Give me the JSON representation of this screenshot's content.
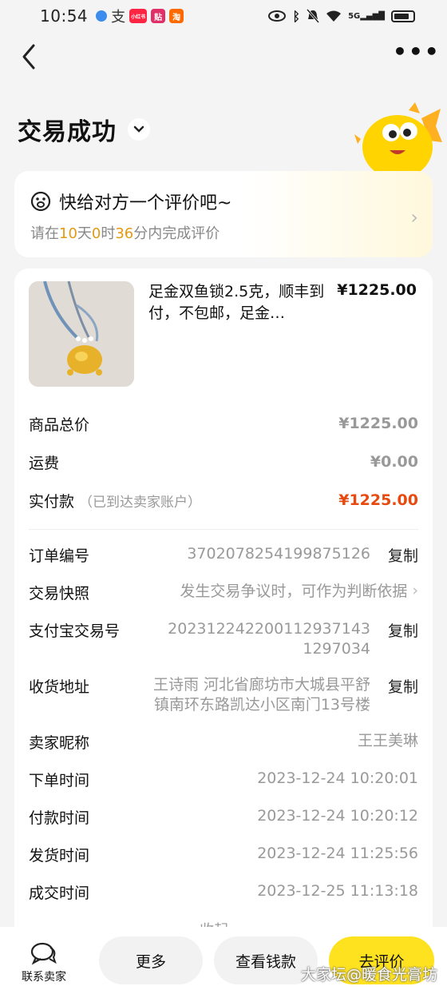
{
  "status_bar": {
    "time": "10:54",
    "network": "5G",
    "apps": [
      "小红书",
      "贴",
      "淘"
    ]
  },
  "page_title": "交易成功",
  "review_prompt": {
    "title": "快给对方一个评价吧~",
    "sub_prefix": "请在",
    "days": "10",
    "days_unit": "天",
    "hours": "0",
    "hours_unit": "时",
    "minutes": "36",
    "minutes_unit": "分内完成评价"
  },
  "product": {
    "title": "足金双鱼锁2.5克，顺丰到付，不包邮，足金…",
    "price": "¥1225.00"
  },
  "prices": {
    "total_label": "商品总价",
    "total_value": "¥1225.00",
    "shipping_label": "运费",
    "shipping_value": "¥0.00",
    "paid_label": "实付款",
    "paid_note": "（已到达卖家账户）",
    "paid_value": "¥1225.00"
  },
  "details": {
    "copy_label": "复制",
    "order_no_label": "订单编号",
    "order_no": "3702078254199875126",
    "snapshot_label": "交易快照",
    "snapshot_value": "发生交易争议时，可作为判断依据",
    "alipay_label": "支付宝交易号",
    "alipay_line1": "20231224220011293714​3",
    "alipay_line2": "1297034",
    "address_label": "收货地址",
    "address_line1": "王诗雨 河北省廊坊市大城县平舒",
    "address_line2": "镇南环东路凯达小区南门13号楼",
    "seller_label": "卖家昵称",
    "seller_value": "王王美琳",
    "order_time_label": "下单时间",
    "order_time": "2023-12-24 10:20:01",
    "pay_time_label": "付款时间",
    "pay_time": "2023-12-24 10:20:12",
    "ship_time_label": "发货时间",
    "ship_time": "2023-12-24 11:25:56",
    "deal_time_label": "成交时间",
    "deal_time": "2023-12-25 11:13:18"
  },
  "collapse_label": "收起",
  "bottom": {
    "contact_label": "联系卖家",
    "more_label": "更多",
    "wallet_label": "查看钱款",
    "review_label": "去评价"
  },
  "watermark": "大家坛@暖食光膏坊",
  "colors": {
    "accent_yellow": "#ffe21f",
    "price_red": "#e8490f",
    "highlight_orange": "#e49a12"
  }
}
